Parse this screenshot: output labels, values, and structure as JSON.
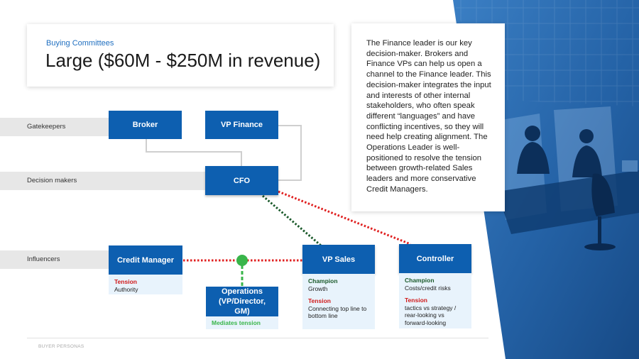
{
  "header": {
    "eyebrow": "Buying Committees",
    "title": "Large ($60M - $250M in revenue)"
  },
  "note": {
    "text": "The Finance leader is our key decision-maker.  Brokers and Finance VPs can help us open a channel to the Finance leader. This decision-maker integrates the input and interests of other internal stakeholders, who often speak different “languages” and have conflicting incentives, so they will need help creating alignment. The Operations Leader is well-positioned to resolve the tension between growth-related Sales leaders and more conservative Credit Managers."
  },
  "lanes": {
    "gatekeepers": "Gatekeepers",
    "decision_makers": "Decision makers",
    "influencers": "Influencers"
  },
  "nodes": {
    "broker": "Broker",
    "vp_finance": "VP Finance",
    "cfo": "CFO",
    "credit_manager": "Credit Manager",
    "operations": "Operations (VP/Director, GM)",
    "vp_sales": "VP Sales",
    "controller": "Controller"
  },
  "details": {
    "credit_manager": {
      "tension_label": "Tension",
      "tension_text": "Authority"
    },
    "operations": {
      "mediates_label": "Mediates tension"
    },
    "vp_sales": {
      "champion_label": "Champion",
      "champion_text": "Growth",
      "tension_label": "Tension",
      "tension_text": "Connecting top line to bottom line"
    },
    "controller": {
      "champion_label": "Champion",
      "champion_text": "Costs/credit risks",
      "tension_label": "Tension",
      "tension_text": "tactics vs strategy / rear-looking vs forward-looking"
    }
  },
  "footer": {
    "label": "BUYER PERSONAS"
  },
  "colors": {
    "node_blue": "#0d5fb0",
    "info_bg": "#e8f3fc",
    "tension_red": "#d01919",
    "champion_green": "#1b5a2b",
    "mediates_green": "#39b54a",
    "photo_blue": "#2a68ad"
  }
}
